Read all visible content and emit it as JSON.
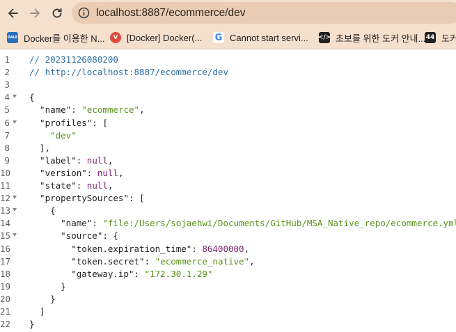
{
  "browser": {
    "url": "localhost:8887/ecommerce/dev",
    "icons": {
      "back": "arrow-left-icon",
      "forward": "arrow-right-icon",
      "reload": "reload-icon",
      "info": "info-icon"
    }
  },
  "bookmarks": [
    {
      "label": "Docker를 이용한 N...",
      "icon": "dale-favicon",
      "icon_text": "DALE",
      "color": "#2a6ebd"
    },
    {
      "label": "[Docker] Docker(...",
      "icon": "velog-favicon",
      "icon_text": "v",
      "color": "#e0483c"
    },
    {
      "label": "Cannot start servi...",
      "icon": "google-favicon",
      "icon_text": "G",
      "color": "#ffffff"
    },
    {
      "label": "초보를 위한 도커 안내...",
      "icon": "code-favicon",
      "icon_text": "</>",
      "color": "#1f1f1f"
    },
    {
      "label": "도커",
      "icon": "number-44-favicon",
      "icon_text": "44",
      "color": "#222222"
    }
  ],
  "code_lines": [
    {
      "n": "1",
      "fold": false,
      "tokens": [
        {
          "t": "// 20231126080200",
          "c": "comment"
        }
      ]
    },
    {
      "n": "2",
      "fold": false,
      "tokens": [
        {
          "t": "// http://localhost:8887/ecommerce/dev",
          "c": "comment"
        }
      ]
    },
    {
      "n": "3",
      "fold": false,
      "tokens": []
    },
    {
      "n": "4",
      "fold": true,
      "tokens": [
        {
          "t": "{",
          "c": "punc"
        }
      ]
    },
    {
      "n": "5",
      "fold": false,
      "tokens": [
        {
          "t": "  \"name\"",
          "c": "key"
        },
        {
          "t": ": ",
          "c": "punc"
        },
        {
          "t": "\"ecommerce\"",
          "c": "str"
        },
        {
          "t": ",",
          "c": "punc"
        }
      ]
    },
    {
      "n": "6",
      "fold": true,
      "tokens": [
        {
          "t": "  \"profiles\"",
          "c": "key"
        },
        {
          "t": ": [",
          "c": "punc"
        }
      ]
    },
    {
      "n": "7",
      "fold": false,
      "tokens": [
        {
          "t": "    \"dev\"",
          "c": "str"
        }
      ]
    },
    {
      "n": "8",
      "fold": false,
      "tokens": [
        {
          "t": "  ],",
          "c": "punc"
        }
      ]
    },
    {
      "n": "9",
      "fold": false,
      "tokens": [
        {
          "t": "  \"label\"",
          "c": "key"
        },
        {
          "t": ": ",
          "c": "punc"
        },
        {
          "t": "null",
          "c": "null"
        },
        {
          "t": ",",
          "c": "punc"
        }
      ]
    },
    {
      "n": "10",
      "fold": false,
      "tokens": [
        {
          "t": "  \"version\"",
          "c": "key"
        },
        {
          "t": ": ",
          "c": "punc"
        },
        {
          "t": "null",
          "c": "null"
        },
        {
          "t": ",",
          "c": "punc"
        }
      ]
    },
    {
      "n": "11",
      "fold": false,
      "tokens": [
        {
          "t": "  \"state\"",
          "c": "key"
        },
        {
          "t": ": ",
          "c": "punc"
        },
        {
          "t": "null",
          "c": "null"
        },
        {
          "t": ",",
          "c": "punc"
        }
      ]
    },
    {
      "n": "12",
      "fold": true,
      "tokens": [
        {
          "t": "  \"propertySources\"",
          "c": "key"
        },
        {
          "t": ": [",
          "c": "punc"
        }
      ]
    },
    {
      "n": "13",
      "fold": true,
      "tokens": [
        {
          "t": "    {",
          "c": "punc"
        }
      ]
    },
    {
      "n": "14",
      "fold": false,
      "tokens": [
        {
          "t": "      \"name\"",
          "c": "key"
        },
        {
          "t": ": ",
          "c": "punc"
        },
        {
          "t": "\"file:/Users/sojaehwi/Documents/GitHub/MSA_Native_repo/ecommerce.yml\"",
          "c": "str"
        },
        {
          "t": ",",
          "c": "punc"
        }
      ]
    },
    {
      "n": "15",
      "fold": true,
      "tokens": [
        {
          "t": "      \"source\"",
          "c": "key"
        },
        {
          "t": ": {",
          "c": "punc"
        }
      ]
    },
    {
      "n": "16",
      "fold": false,
      "tokens": [
        {
          "t": "        \"token.expiration_time\"",
          "c": "key"
        },
        {
          "t": ": ",
          "c": "punc"
        },
        {
          "t": "86400000",
          "c": "num"
        },
        {
          "t": ",",
          "c": "punc"
        }
      ]
    },
    {
      "n": "17",
      "fold": false,
      "tokens": [
        {
          "t": "        \"token.secret\"",
          "c": "key"
        },
        {
          "t": ": ",
          "c": "punc"
        },
        {
          "t": "\"ecommerce_native\"",
          "c": "str"
        },
        {
          "t": ",",
          "c": "punc"
        }
      ]
    },
    {
      "n": "18",
      "fold": false,
      "tokens": [
        {
          "t": "        \"gateway.ip\"",
          "c": "key"
        },
        {
          "t": ": ",
          "c": "punc"
        },
        {
          "t": "\"172.30.1.29\"",
          "c": "str"
        }
      ]
    },
    {
      "n": "19",
      "fold": false,
      "tokens": [
        {
          "t": "      }",
          "c": "punc"
        }
      ]
    },
    {
      "n": "20",
      "fold": false,
      "tokens": [
        {
          "t": "    }",
          "c": "punc"
        }
      ]
    },
    {
      "n": "21",
      "fold": false,
      "tokens": [
        {
          "t": "  ]",
          "c": "punc"
        }
      ]
    },
    {
      "n": "22",
      "fold": false,
      "tokens": [
        {
          "t": "}",
          "c": "punc"
        }
      ]
    }
  ]
}
